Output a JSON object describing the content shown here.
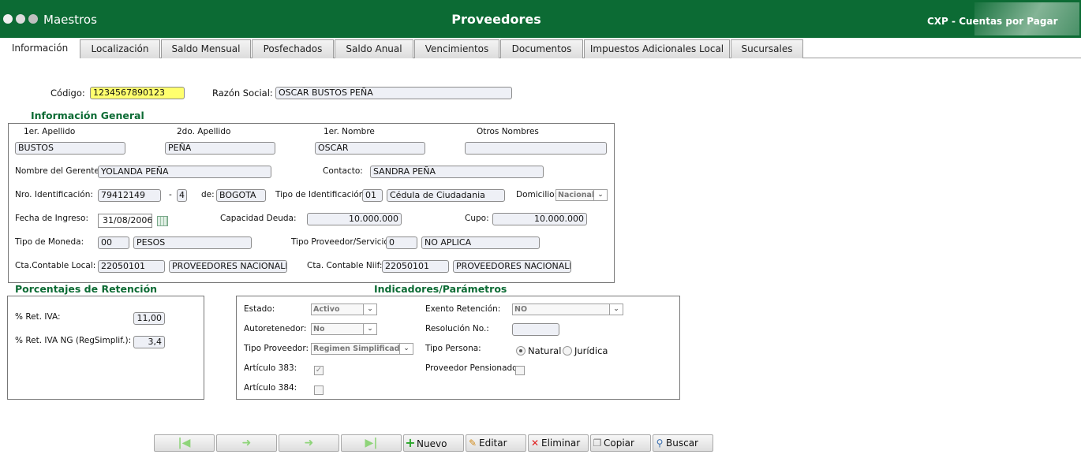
{
  "header": {
    "module": "Maestros",
    "title": "Proveedores",
    "app": "CXP - Cuentas por Pagar"
  },
  "tabs": [
    "Información",
    "Localización",
    "Saldo Mensual",
    "Posfechados",
    "Saldo Anual",
    "Vencimientos",
    "Documentos",
    "Impuestos Adicionales Local",
    "Sucursales"
  ],
  "top": {
    "codigo_label": "Código:",
    "codigo": "1234567890123",
    "razon_label": "Razón Social:",
    "razon": "OSCAR BUSTOS PEÑA"
  },
  "general": {
    "title": "Información General",
    "apellido1_label": "1er. Apellido",
    "apellido2_label": "2do. Apellido",
    "nombre1_label": "1er. Nombre",
    "otros_label": "Otros Nombres",
    "apellido1": "BUSTOS",
    "apellido2": "PEÑA",
    "nombre1": "OSCAR",
    "otros": "",
    "gerente_label": "Nombre del Gerente:",
    "gerente": "YOLANDA PEÑA",
    "contacto_label": "Contacto:",
    "contacto": "SANDRA PEÑA",
    "nroid_label": "Nro. Identificación:",
    "nroid": "79412149",
    "dash": "-",
    "dv": "4",
    "de_label": "de:",
    "ciudad": "BOGOTA",
    "tipoid_label": "Tipo de Identificación:",
    "tipoid_code": "01",
    "tipoid_name": "Cédula de Ciudadania",
    "domicilio_label": "Domicilio:",
    "domicilio": "Nacional",
    "fecha_label": "Fecha de Ingreso:",
    "fecha": "31/08/2006",
    "capacidad_label": "Capacidad Deuda:",
    "capacidad": "10.000.000",
    "cupo_label": "Cupo:",
    "cupo": "10.000.000",
    "moneda_label": "Tipo de Moneda:",
    "moneda_code": "00",
    "moneda_name": "PESOS",
    "tipoprov_label": "Tipo Proveedor/Servicio:",
    "tipoprov_code": "0",
    "tipoprov_name": "NO APLICA",
    "ctalocal_label": "Cta.Contable Local:",
    "ctalocal_code": "22050101",
    "ctalocal_name": "PROVEEDORES NACIONALES",
    "ctaniif_label": "Cta. Contable Niif:",
    "ctaniif_code": "22050101",
    "ctaniif_name": "PROVEEDORES NACIONALES"
  },
  "retencion": {
    "title": "Porcentajes de Retención",
    "iva_label": "% Ret. IVA:",
    "iva": "11,00",
    "ivang_label": "% Ret. IVA NG (RegSimplif.):",
    "ivang": "3,4"
  },
  "indicadores": {
    "title": "Indicadores/Parámetros",
    "estado_label": "Estado:",
    "estado": "Activo",
    "autoret_label": "Autoretenedor:",
    "autoret": "No",
    "tipoprov_label": "Tipo Proveedor:",
    "tipoprov": "Regimen Simplificado",
    "art383_label": "Artículo 383:",
    "art384_label": "Artículo 384:",
    "exento_label": "Exento Retención:",
    "exento": "NO",
    "resolucion_label": "Resolución No.:",
    "resolucion": "",
    "tipopersona_label": "Tipo Persona:",
    "natural": "Natural",
    "juridica": "Jurídica",
    "pensionado_label": "Proveedor Pensionado:"
  },
  "toolbar": {
    "nuevo": "Nuevo",
    "editar": "Editar",
    "eliminar": "Eliminar",
    "copiar": "Copiar",
    "buscar": "Buscar"
  }
}
